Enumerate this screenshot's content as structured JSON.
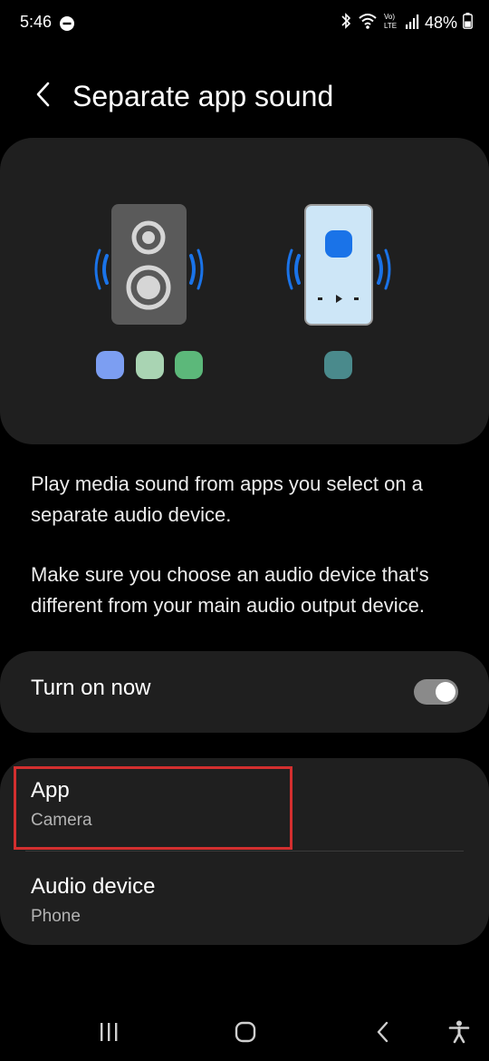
{
  "status_bar": {
    "time": "5:46",
    "battery": "48%",
    "icons": [
      "do-not-disturb-icon",
      "bluetooth-icon",
      "wifi-icon",
      "volte-icon",
      "signal-icon",
      "battery-icon"
    ]
  },
  "header": {
    "title": "Separate app sound",
    "back_icon": "back-arrow-icon"
  },
  "illustration": {
    "left_device": "speaker",
    "right_device": "phone",
    "left_app_dots": [
      "#7c9ef2",
      "#a9d4b3",
      "#5cb87a"
    ],
    "right_app_dots": [
      "#4a8a8c"
    ],
    "accent": "#1a73e8"
  },
  "description": {
    "paragraph_1": "Play media sound from apps you select on a separate audio device.",
    "paragraph_2": "Make sure you choose an audio device that's different from your main audio output device."
  },
  "toggle": {
    "label": "Turn on now",
    "state": "on"
  },
  "settings": {
    "app": {
      "title": "App",
      "value": "Camera"
    },
    "audio_device": {
      "title": "Audio device",
      "value": "Phone"
    }
  },
  "nav_bar": {
    "icons": [
      "recent-apps-icon",
      "home-icon",
      "back-icon",
      "accessibility-icon"
    ]
  },
  "colors": {
    "background": "#000000",
    "card": "#1f1f1f",
    "highlight": "#d32f2f"
  }
}
